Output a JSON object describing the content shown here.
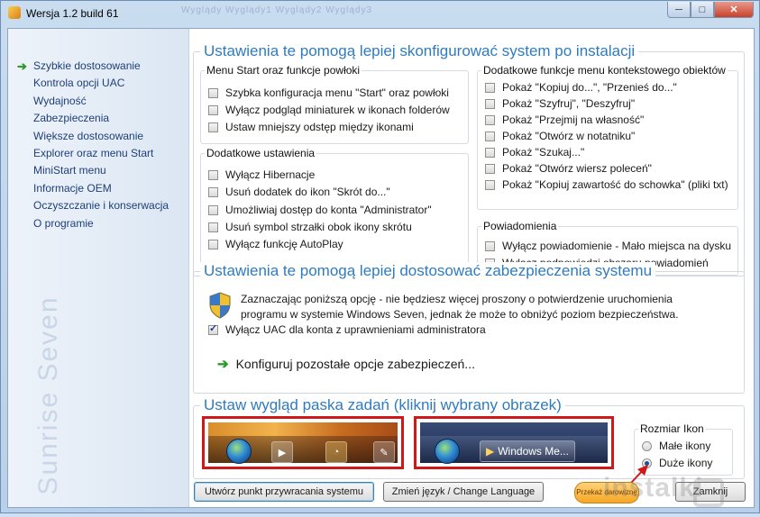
{
  "window": {
    "title": "Wersja 1.2 build 61",
    "ghost_tabs": "Wyglądy   Wyglądy1   Wyglądy2   Wyglądy3",
    "minimize": "─",
    "maximize": "□",
    "close": "✕"
  },
  "sidebar": {
    "brand": "Sunrise Seven",
    "items": [
      {
        "label": "Szybkie dostosowanie",
        "active": true
      },
      {
        "label": "Kontrola opcji UAC"
      },
      {
        "label": "Wydajność"
      },
      {
        "label": "Zabezpieczenia"
      },
      {
        "label": "Większe dostosowanie"
      },
      {
        "label": "Explorer oraz menu Start"
      },
      {
        "label": "MiniStart menu"
      },
      {
        "label": "Informacje OEM"
      },
      {
        "label": "Oczyszczanie i konserwacja"
      },
      {
        "label": "O programie"
      }
    ]
  },
  "system_section": {
    "title": "Ustawienia te pomogą lepiej skonfigurować system po instalacji",
    "menu_start": {
      "title": "Menu Start oraz funkcje powłoki",
      "options": [
        "Szybka konfiguracja menu \"Start\" oraz powłoki",
        "Wyłącz podgląd miniaturek w ikonach folderów",
        "Ustaw mniejszy odstęp między ikonami"
      ]
    },
    "extra": {
      "title": "Dodatkowe ustawienia",
      "options": [
        "Wyłącz Hibernacje",
        "Usuń dodatek do ikon \"Skrót do...\"",
        "Umożliwiaj dostęp do konta \"Administrator\"",
        "Usuń symbol strzałki obok ikony skrótu",
        "Wyłącz funkcję AutoPlay"
      ]
    },
    "context_menu": {
      "title": "Dodatkowe funkcje menu kontekstowego obiektów",
      "options": [
        "Pokaż \"Kopiuj do...\", \"Przenieś do...\"",
        "Pokaż \"Szyfruj\", \"Deszyfruj\"",
        "Pokaż \"Przejmij na własność\"",
        "Pokaż \"Otwórz w notatniku\"",
        "Pokaż \"Szukaj...\"",
        "Pokaż \"Otwórz wiersz poleceń\"",
        "Pokaż \"Kopiuj zawartość do schowka\" (pliki txt)"
      ]
    },
    "notifications": {
      "title": "Powiadomienia",
      "options": [
        "Wyłącz powiadomienie - Mało miejsca na dysku",
        "Wyłącz podpowiedzi obszaru powiadomień"
      ]
    }
  },
  "security_section": {
    "title": "Ustawienia te pomogą lepiej dostosować zabezpieczenia systemu",
    "description": "Zaznaczając poniższą opcję - nie będziesz więcej proszony o potwierdzenie uruchomienia programu w systemie Windows Seven, jednak że może to obniżyć poziom bezpieczeństwa.",
    "uac_option": "Wyłącz UAC dla konta z uprawnieniami administratora",
    "uac_checked": true,
    "link": "Konfiguruj pozostałe opcje zabezpieczeń..."
  },
  "taskbar_section": {
    "title": "Ustaw wygląd paska zadań (kliknij wybrany obrazek)",
    "preview2_button": "Windows Me...",
    "icon_size": {
      "title": "Rozmiar Ikon",
      "small": "Małe ikony",
      "large": "Duże ikony",
      "selected": "large"
    }
  },
  "footer": {
    "restore_button": "Utwórz punkt przywracania systemu",
    "language_button": "Zmień język / Change Language",
    "donate_button": "Przekaż darowiznę",
    "close_button": "Zamknij",
    "watermark": "instalki"
  },
  "colors": {
    "title_blue": "#2f7bbf",
    "nav_link": "#1e3f7a",
    "highlight_red": "#d01818",
    "green_arrow": "#2c9a2c"
  }
}
